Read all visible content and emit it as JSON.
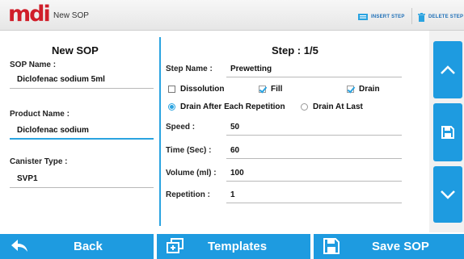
{
  "header": {
    "logo": "mdi",
    "title": "New SOP",
    "insert_step": "INSERT STEP",
    "delete_step": "DELETE STEP"
  },
  "left": {
    "title": "New SOP",
    "sop_name_label": "SOP Name :",
    "sop_name_value": "Diclofenac sodium 5ml",
    "product_name_label": "Product Name :",
    "product_name_value": "Diclofenac sodium",
    "canister_type_label": "Canister Type :",
    "canister_type_value": "SVP1"
  },
  "step": {
    "title": "Step : 1/5",
    "step_name_label": "Step Name :",
    "step_name_value": "Prewetting",
    "options": [
      {
        "label": "Dissolution",
        "checked": false
      },
      {
        "label": "Fill",
        "checked": true
      },
      {
        "label": "Drain",
        "checked": true
      }
    ],
    "radios": [
      {
        "label": "Drain After Each Repetition",
        "selected": true
      },
      {
        "label": "Drain At Last",
        "selected": false
      }
    ],
    "speed_label": "Speed :",
    "speed_value": "50",
    "time_label": "Time (Sec) :",
    "time_value": "60",
    "volume_label": "Volume (ml) :",
    "volume_value": "100",
    "repetition_label": "Repetition :",
    "repetition_value": "1"
  },
  "footer": {
    "back": "Back",
    "templates": "Templates",
    "save": "Save SOP"
  },
  "colors": {
    "accent": "#1e9be0",
    "brand": "#d01e2a",
    "divider": "#2aa3e0"
  }
}
